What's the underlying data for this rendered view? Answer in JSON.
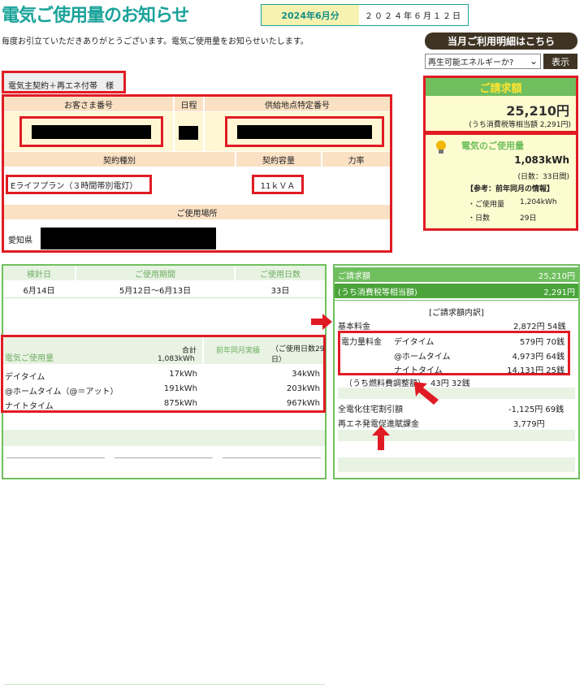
{
  "header": {
    "title": "電気ご使用量のお知らせ",
    "month": "2024年6月分",
    "date": "２０２４年６月１２日",
    "greeting": "毎度お引立ていただきありがとうございます。電気ご使用量をお知らせいたします。"
  },
  "detail_button": "当月ご利用明細はこちら",
  "select": {
    "value": "再生可能エネルギーか?",
    "show_label": "表示"
  },
  "contract": {
    "name": "電気主契約＋再エネ付帯　様"
  },
  "info": {
    "customer_no_label": "お客さま番号",
    "schedule_label": "日程",
    "supply_point_label": "供給地点特定番号",
    "contract_type_label": "契約種別",
    "contract_type_value": "Eライフプラン（３時間帯別電灯）",
    "capacity_label": "契約容量",
    "capacity_value": "11ｋＶＡ",
    "power_factor_label": "力率",
    "location_label": "ご使用場所",
    "location_value": "愛知県"
  },
  "bill": {
    "label": "ご請求額",
    "amount": "25,210円",
    "tax": "(うち消費税等相当額 2,291円)"
  },
  "usage": {
    "label": "電気のご使用量",
    "amount": "1,083kWh",
    "days": "(日数：33日間)",
    "ref_title": "【参考：前年同月の情報】",
    "prev_usage_label": "・ご使用量",
    "prev_usage_value": "1,204kWh",
    "prev_days_label": "・日数",
    "prev_days_value": "29日"
  },
  "period": {
    "headers": [
      "検針日",
      "ご使用期間",
      "ご使用日数"
    ],
    "values": [
      "6月14日",
      "5月12日～6月13日",
      "33日"
    ]
  },
  "usage_table": {
    "title": "電気ご使用量",
    "total_label": "合計",
    "total_value": "1,083kWh",
    "prev_label": "前年同月実績",
    "prev_days": "（ご使用日数29日）",
    "rows": [
      {
        "name": "デイタイム",
        "cur": "17kWh",
        "prev": "34kWh"
      },
      {
        "name": "@ホームタイム（@＝アット）",
        "cur": "191kWh",
        "prev": "203kWh"
      },
      {
        "name": "ナイトタイム",
        "cur": "875kWh",
        "prev": "967kWh"
      }
    ]
  },
  "charges": {
    "bill_label": "ご請求額",
    "bill_value": "25,210円",
    "tax_label": "(うち消費税等相当額)",
    "tax_value": "2,291円",
    "breakdown_title": "[ご請求額内訳]",
    "base_label": "基本料金",
    "base_value": "2,872円 54銭",
    "power_label": "電力量料金",
    "rows": [
      {
        "name": "デイタイム",
        "value": "579円 70銭"
      },
      {
        "name": "@ホームタイム",
        "value": "4,973円 64銭"
      },
      {
        "name": "ナイトタイム",
        "value": "14,131円 25銭"
      }
    ],
    "fuel_label": "（うち燃料費調整額）",
    "fuel_value": "43円 32銭",
    "discount_label": "全電化住宅割引額",
    "discount_value": "-1,125円 69銭",
    "renew_label": "再エネ発電促進賦課金",
    "renew_value": "3,779円"
  }
}
